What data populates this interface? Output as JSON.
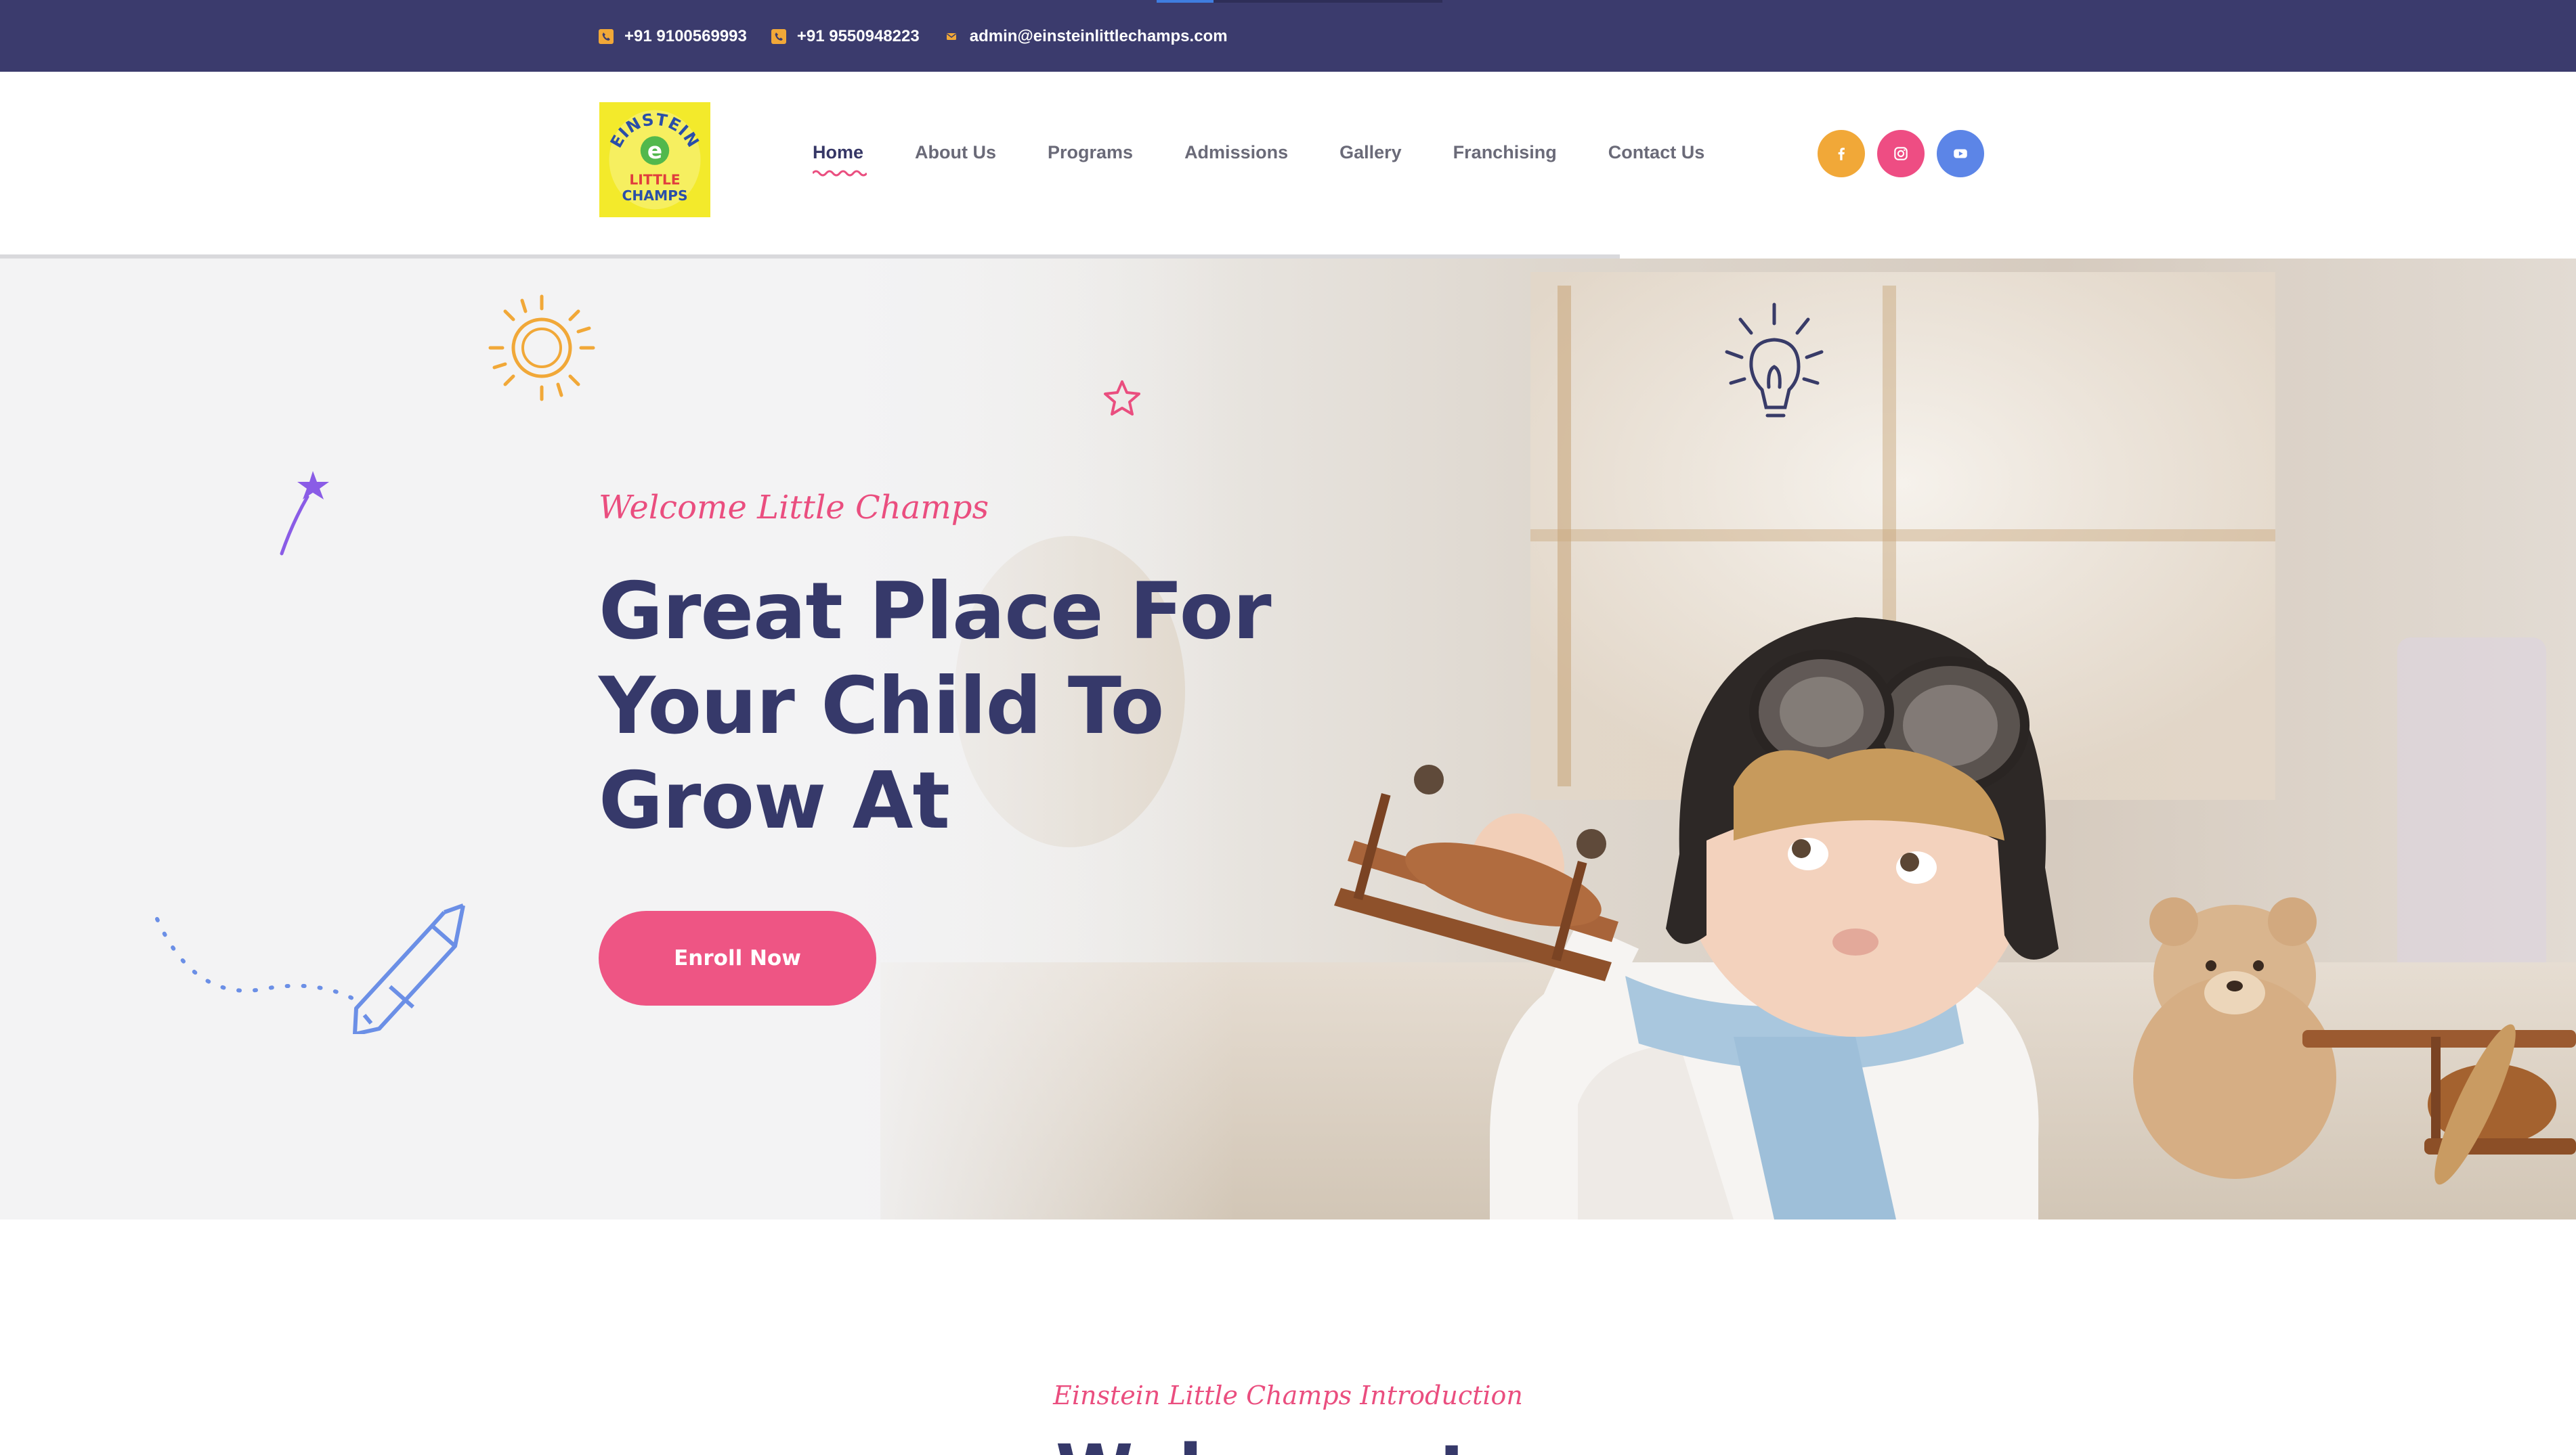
{
  "topbar": {
    "phone1": "+91 9100569993",
    "phone2": "+91 9550948223",
    "email": "admin@einsteinlittlechamps.com",
    "icons": [
      "phone-icon",
      "phone-icon",
      "envelope-icon"
    ],
    "accent_color": "#f1a838",
    "background_color": "#3b3b6d"
  },
  "logo": {
    "line1": "EINSTEIN",
    "mark": "e",
    "line2": "LITTLE",
    "line3": "CHAMPS",
    "background_color": "#f3ea2b"
  },
  "nav": {
    "items": [
      {
        "label": "Home",
        "active": true
      },
      {
        "label": "About Us"
      },
      {
        "label": "Programs"
      },
      {
        "label": "Admissions"
      },
      {
        "label": "Gallery"
      },
      {
        "label": "Franchising"
      },
      {
        "label": "Contact Us"
      }
    ]
  },
  "socials": [
    {
      "icon": "facebook-icon",
      "color": "#f1a838"
    },
    {
      "icon": "instagram-icon",
      "color": "#ee4d83"
    },
    {
      "icon": "youtube-icon",
      "color": "#5c85e7"
    }
  ],
  "hero": {
    "subtitle": "Welcome Little Champs",
    "title_line1": "Great Place For",
    "title_line2": "Your Child To",
    "title_line3": "Grow At",
    "button_label": "Enroll Now",
    "button_color": "#ee5584",
    "decorations": [
      "sun-icon",
      "magic-wand-icon",
      "star-icon",
      "lightbulb-icon",
      "pencil-icon"
    ]
  },
  "intro": {
    "subtitle": "Einstein Little Champs Introduction",
    "title": "Welcome to"
  }
}
